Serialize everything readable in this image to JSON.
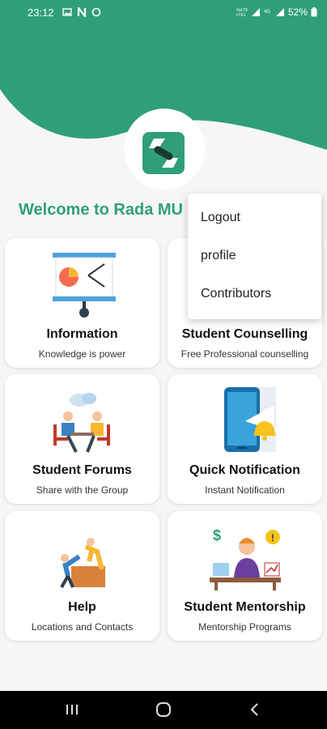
{
  "status_bar": {
    "time": "23:12",
    "battery": "52%"
  },
  "welcome_text": "Welcome to Rada MU",
  "menu": {
    "items": [
      "Logout",
      "profile",
      "Contributors"
    ]
  },
  "cards": [
    {
      "title": "Information",
      "subtitle": "Knowledge is power"
    },
    {
      "title": "Student Counselling",
      "subtitle": "Free Professional counselling"
    },
    {
      "title": "Student Forums",
      "subtitle": "Share with the Group"
    },
    {
      "title": "Quick Notification",
      "subtitle": "Instant Notification"
    },
    {
      "title": "Help",
      "subtitle": "Locations and Contacts"
    },
    {
      "title": "Student Mentorship",
      "subtitle": "Mentorship Programs"
    }
  ],
  "colors": {
    "primary": "#2f9f78",
    "background": "#f6f6f6"
  }
}
